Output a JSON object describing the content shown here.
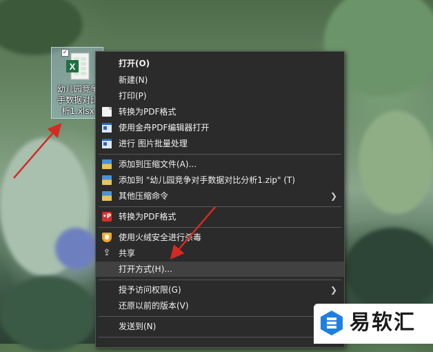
{
  "desktop": {
    "file": {
      "label": "幼儿园竞争\n手数据对比\n析1.xlsx",
      "icon": "excel-icon",
      "checked": true
    }
  },
  "context_menu": {
    "items": [
      {
        "label": "打开(O)",
        "bold": true,
        "icon": null
      },
      {
        "label": "新建(N)",
        "icon": null
      },
      {
        "label": "打印(P)",
        "icon": null
      },
      {
        "label": "转换为PDF格式",
        "icon": "document-icon"
      },
      {
        "label": "使用金舟PDF编辑器打开",
        "icon": "app-window-icon"
      },
      {
        "label": "进行 图片批量处理",
        "icon": "app-window-icon"
      },
      {
        "label": "添加到压缩文件(A)...",
        "icon": "archive-icon"
      },
      {
        "label": "添加到 \"幼儿园竞争对手数据对比分析1.zip\" (T)",
        "icon": "archive-icon"
      },
      {
        "label": "其他压缩命令",
        "icon": "archive-icon",
        "submenu": true
      },
      {
        "label": "转换为PDF格式",
        "icon": "pdf-convert-icon"
      },
      {
        "label": "使用火绒安全进行杀毒",
        "icon": "shield-icon"
      },
      {
        "label": "共享",
        "icon": "share-icon"
      },
      {
        "label": "打开方式(H)...",
        "icon": null,
        "highlighted": true
      },
      {
        "label": "授予访问权限(G)",
        "icon": null,
        "submenu": true
      },
      {
        "label": "还原以前的版本(V)",
        "icon": null
      },
      {
        "label": "发送到(N)",
        "icon": null,
        "submenu": true
      }
    ]
  },
  "watermark": {
    "text": "易软汇",
    "icon": "brand-logo-icon",
    "color": "#1f7fe0"
  },
  "colors": {
    "menu_bg": "#2b2b2b",
    "menu_highlight": "#414141",
    "arrow": "#d42a22"
  }
}
